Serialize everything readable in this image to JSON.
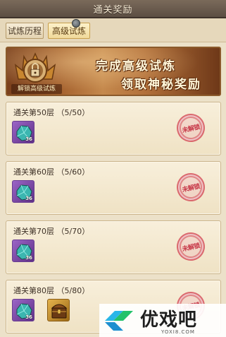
{
  "window": {
    "title": "通关奖励"
  },
  "tabs": [
    {
      "label": "试炼历程",
      "active": false
    },
    {
      "label": "高级试炼",
      "active": true
    }
  ],
  "banner": {
    "crest_label": "解锁高级试炼",
    "line1": "完成高级试炼",
    "line2": "领取神秘奖励"
  },
  "rewards": [
    {
      "title": "通关第50层 （5/50）",
      "items": [
        {
          "icon": "crystal-ore-icon",
          "count": "36"
        }
      ],
      "status": "未解锁"
    },
    {
      "title": "通关第60层 （5/60）",
      "items": [
        {
          "icon": "crystal-ore-icon",
          "count": "36"
        }
      ],
      "status": "未解锁"
    },
    {
      "title": "通关第70层 （5/70）",
      "items": [
        {
          "icon": "crystal-ore-icon",
          "count": "36"
        }
      ],
      "status": "未解锁"
    },
    {
      "title": "通关第80层 （5/80）",
      "items": [
        {
          "icon": "crystal-ore-icon",
          "count": "36"
        },
        {
          "icon": "treasure-chest-icon",
          "count": ""
        }
      ],
      "status": "未解锁"
    }
  ],
  "watermark": {
    "main": "优戏吧",
    "sub": "YOXI8.COM"
  },
  "colors": {
    "accent": "#8b5a2b",
    "stamp": "#c83a4a",
    "item_purple": "#7b45a8"
  }
}
